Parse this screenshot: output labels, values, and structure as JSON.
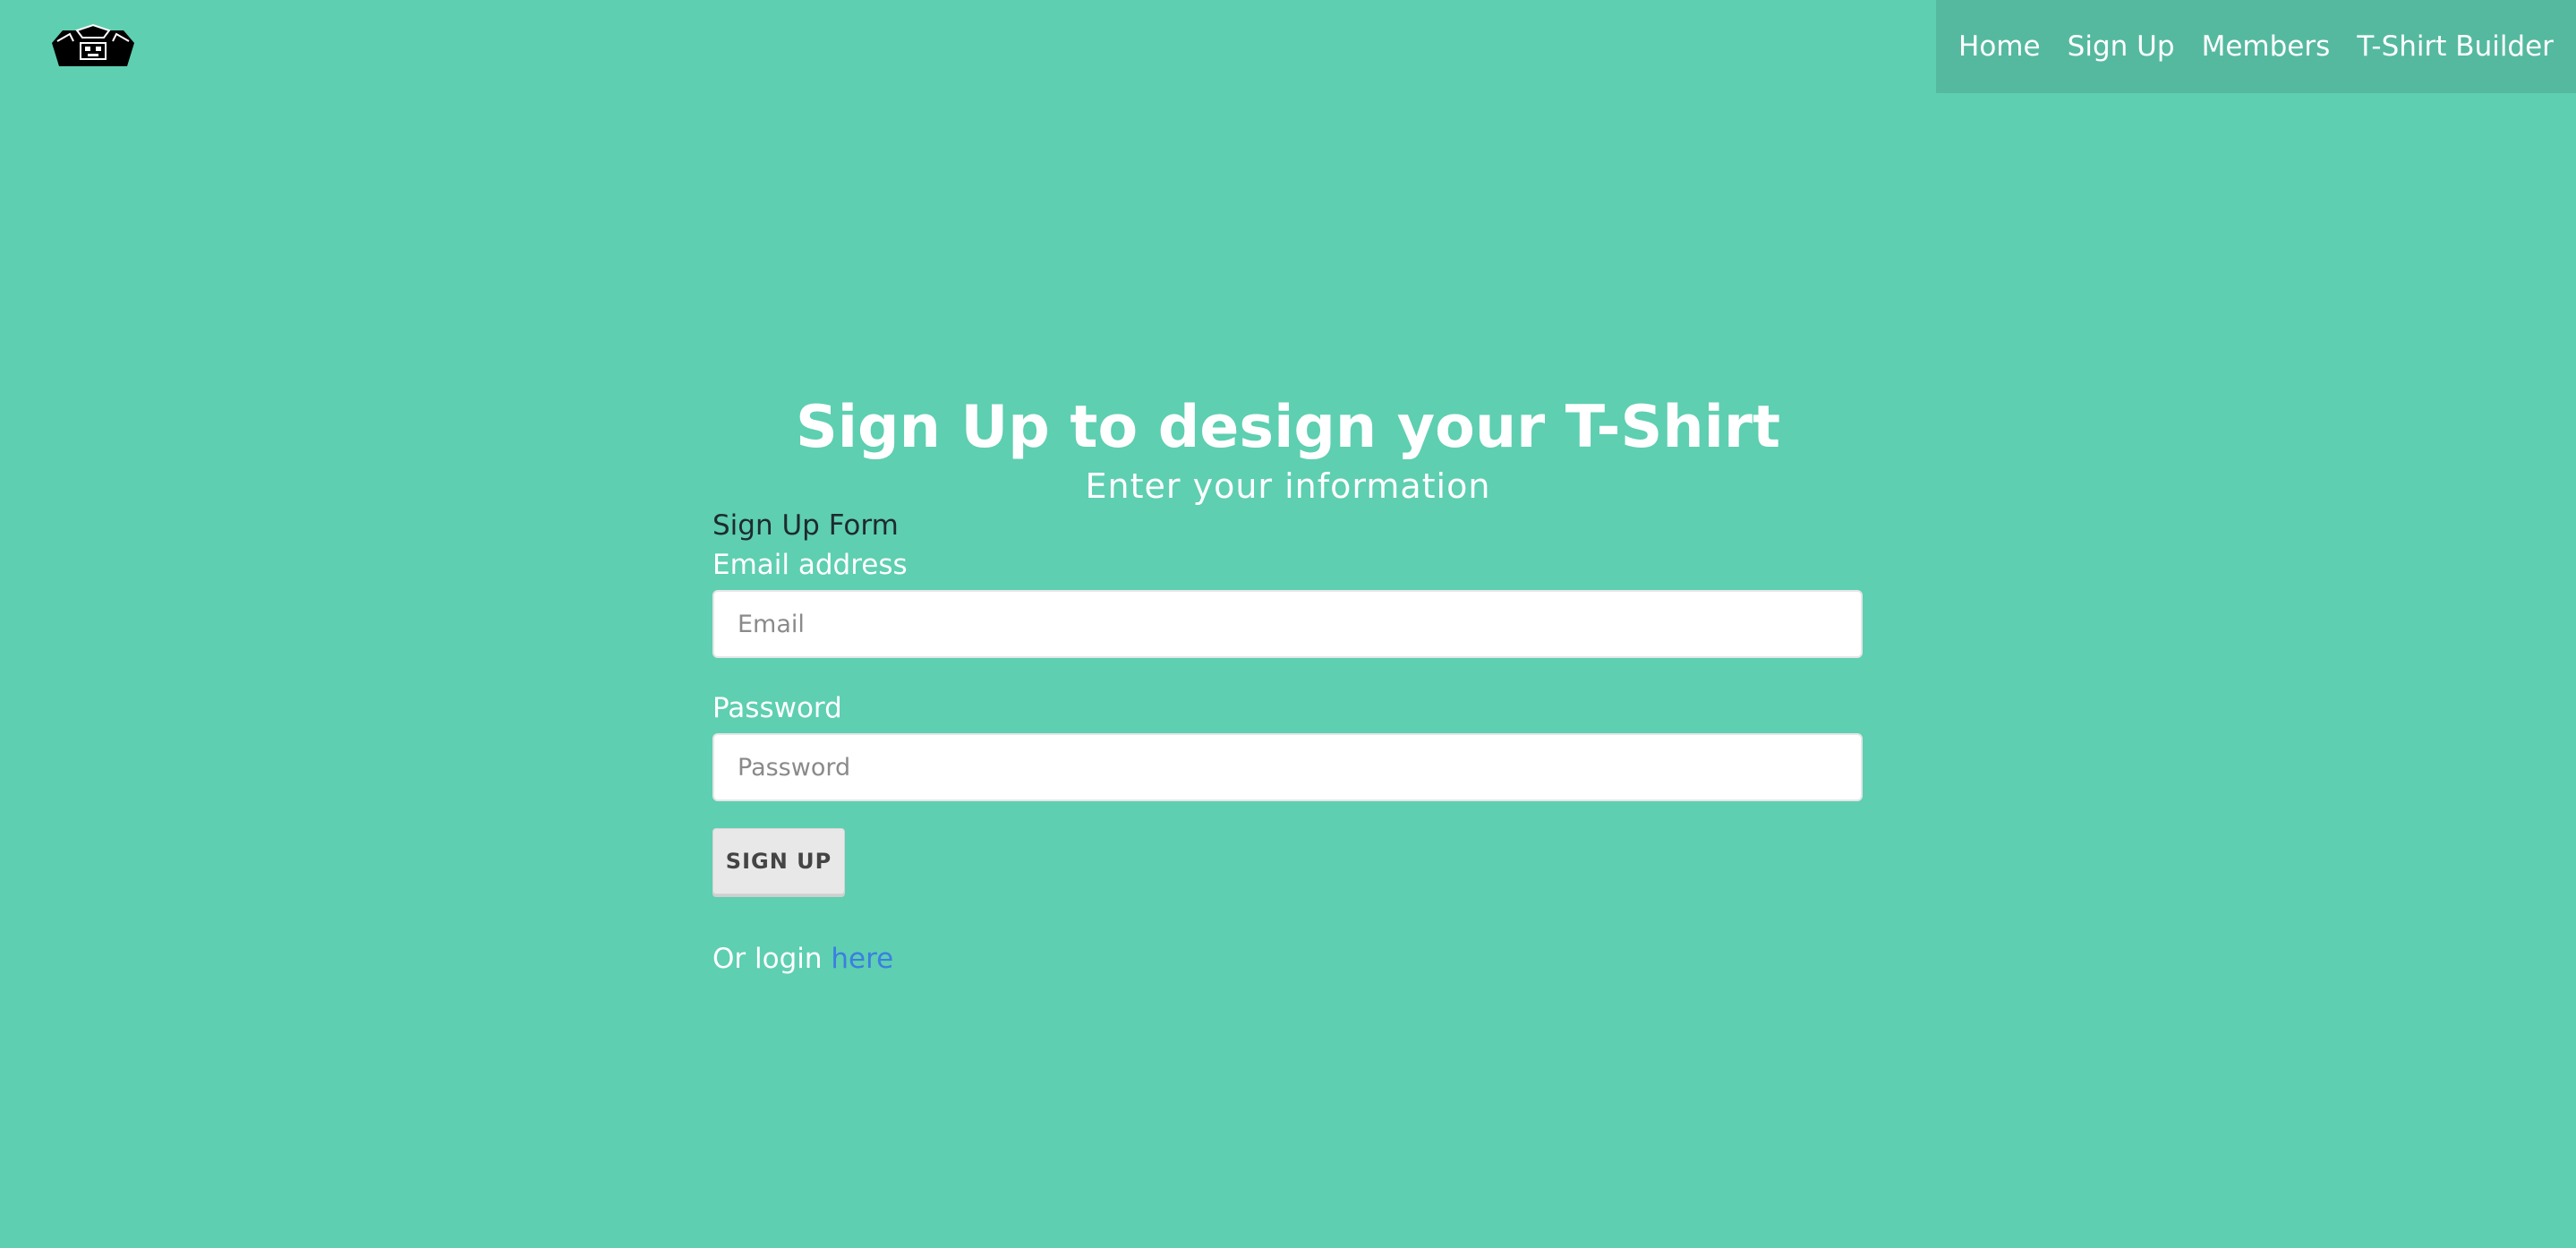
{
  "header": {
    "logo_icon": "tshirt-logo-icon",
    "nav": {
      "home": "Home",
      "signup": "Sign Up",
      "members": "Members",
      "tshirt_builder": "T-Shirt Builder"
    },
    "nav_background": "#55b9a0"
  },
  "hero": {
    "title": "Sign Up to design your T-Shirt",
    "subtitle": "Enter your information"
  },
  "form": {
    "heading": "Sign Up Form",
    "email_label": "Email address",
    "email_placeholder": "Email",
    "email_value": "",
    "password_label": "Password",
    "password_placeholder": "Password",
    "password_value": "",
    "submit_label": "SIGN UP",
    "login_prefix": "Or login",
    "login_link": "here"
  },
  "colors": {
    "background": "#5ecfb1",
    "link": "#3b7fe0"
  }
}
